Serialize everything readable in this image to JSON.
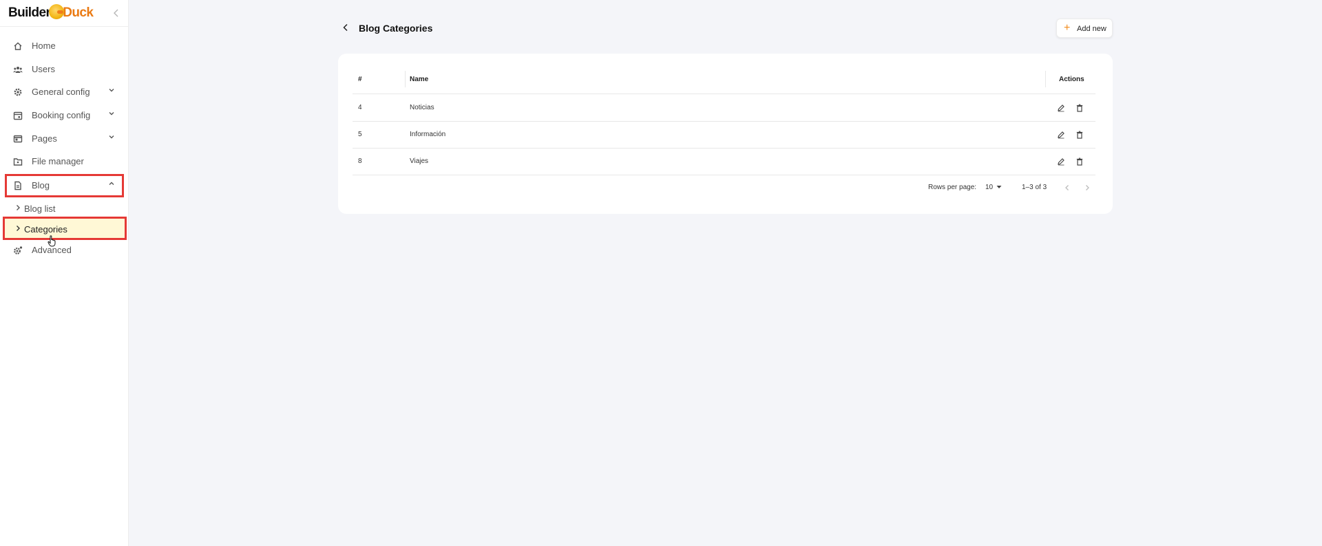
{
  "app": {
    "logo_part1": "Builder",
    "logo_part2": "Duck"
  },
  "sidebar": {
    "items": [
      {
        "label": "Home",
        "icon": "home-icon"
      },
      {
        "label": "Users",
        "icon": "users-icon"
      },
      {
        "label": "General config",
        "icon": "gear-icon",
        "expandable": true
      },
      {
        "label": "Booking config",
        "icon": "calendar-icon",
        "expandable": true
      },
      {
        "label": "Pages",
        "icon": "pages-icon",
        "expandable": true
      },
      {
        "label": "File manager",
        "icon": "folder-icon"
      },
      {
        "label": "Blog",
        "icon": "document-icon",
        "expanded": true
      },
      {
        "label": "Advanced",
        "icon": "advanced-gear-icon"
      }
    ],
    "blog_sub": [
      {
        "label": "Blog list"
      },
      {
        "label": "Categories",
        "active": true
      }
    ]
  },
  "main": {
    "title": "Blog Categories",
    "add_button": "Add new",
    "table": {
      "headers": {
        "id": "#",
        "name": "Name",
        "actions": "Actions"
      },
      "rows": [
        {
          "id": "4",
          "name": "Noticias"
        },
        {
          "id": "5",
          "name": "Información"
        },
        {
          "id": "8",
          "name": "Viajes"
        }
      ]
    },
    "pagination": {
      "rows_per_page_label": "Rows per page:",
      "rows_per_page_value": "10",
      "range": "1–3 of 3"
    }
  },
  "colors": {
    "accent": "#ea7a13",
    "highlight": "#e53935",
    "active_bg": "#fff8d6"
  }
}
